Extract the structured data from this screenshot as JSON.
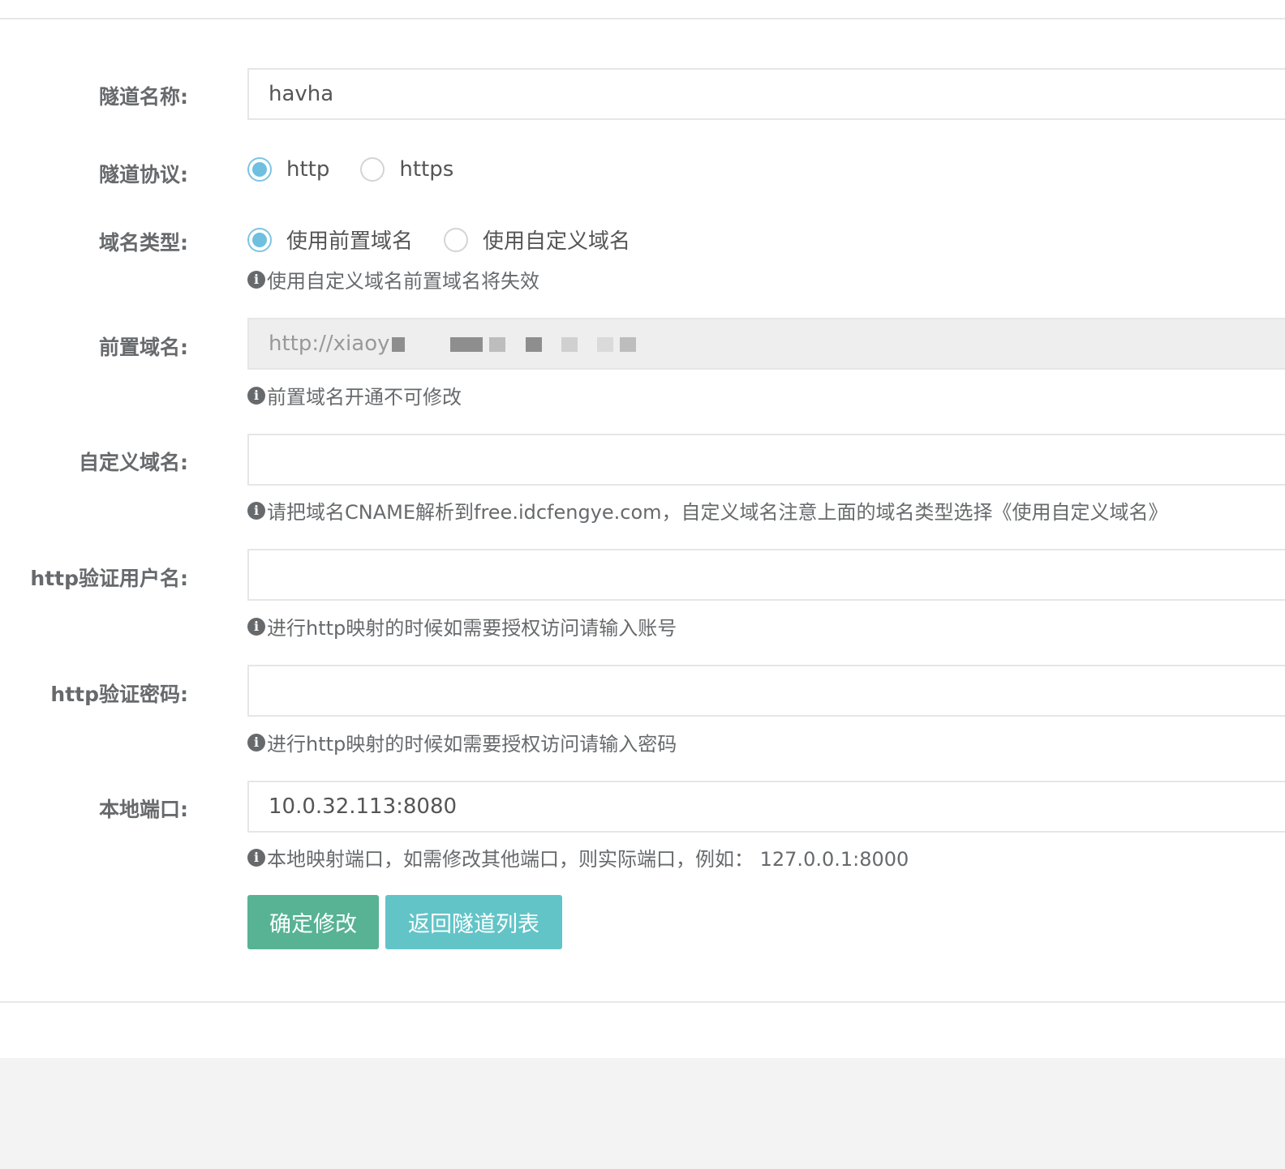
{
  "form": {
    "tunnel_name": {
      "label": "隧道名称:",
      "value": "havha"
    },
    "tunnel_protocol": {
      "label": "隧道协议:",
      "options": [
        "http",
        "https"
      ],
      "selected": "http"
    },
    "domain_type": {
      "label": "域名类型:",
      "options": [
        "使用前置域名",
        "使用自定义域名"
      ],
      "selected": "使用前置域名",
      "help": "使用自定义域名前置域名将失效"
    },
    "prefix_domain": {
      "label": "前置域名:",
      "value": "http://xiaoy",
      "help": "前置域名开通不可修改"
    },
    "custom_domain": {
      "label": "自定义域名:",
      "value": "",
      "help": "请把域名CNAME解析到free.idcfengye.com，自定义域名注意上面的域名类型选择《使用自定义域名》"
    },
    "http_user": {
      "label": "http验证用户名:",
      "value": "",
      "help": "进行http映射的时候如需要授权访问请输入账号"
    },
    "http_password": {
      "label": "http验证密码:",
      "value": "",
      "help": "进行http映射的时候如需要授权访问请输入密码"
    },
    "local_port": {
      "label": "本地端口:",
      "value": "10.0.32.113:8080",
      "help": "本地映射端口，如需修改其他端口，则实际端口，例如： 127.0.0.1:8000"
    }
  },
  "buttons": {
    "confirm": "确定修改",
    "back": "返回隧道列表"
  },
  "colors": {
    "confirm_button": "#57b394",
    "back_button": "#62c4c7",
    "radio_checked": "#6fbfe0"
  },
  "icons": {
    "help": "info-circle-icon"
  }
}
